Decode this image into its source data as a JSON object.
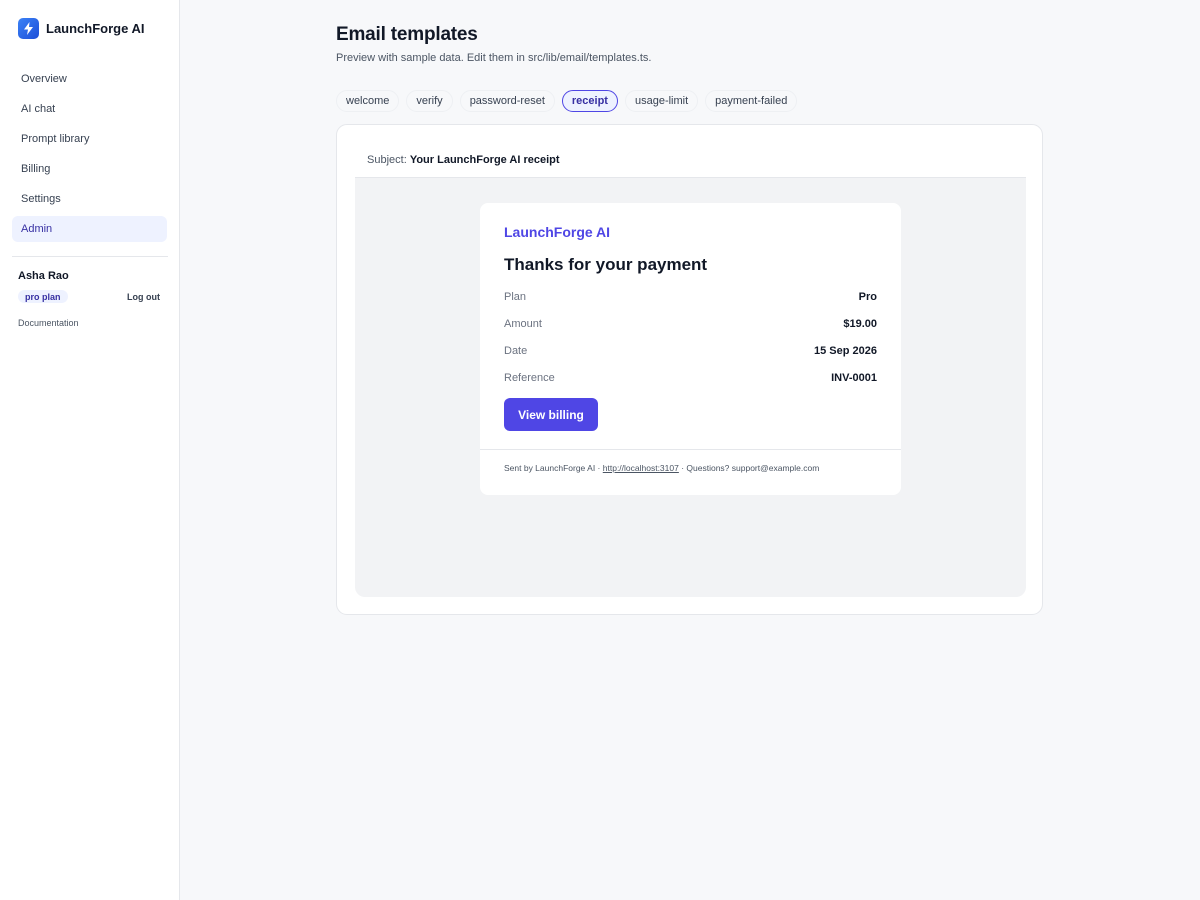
{
  "brand": {
    "name": "LaunchForge AI",
    "logo_icon": "lightning-bolt-icon",
    "logo_color": "#3b82f6"
  },
  "nav": {
    "items": [
      {
        "label": "Overview"
      },
      {
        "label": "AI chat"
      },
      {
        "label": "Prompt library"
      },
      {
        "label": "Billing"
      },
      {
        "label": "Settings"
      },
      {
        "label": "Admin",
        "active": true
      }
    ]
  },
  "user": {
    "name": "Asha Rao",
    "plan": "pro plan",
    "logout_label": "Log out"
  },
  "docs_label": "Documentation",
  "page": {
    "title": "Email templates",
    "subtitle": "Preview with sample data. Edit them in src/lib/email/templates.ts."
  },
  "tabs": [
    {
      "label": "welcome"
    },
    {
      "label": "verify"
    },
    {
      "label": "password-reset"
    },
    {
      "label": "receipt",
      "active": true
    },
    {
      "label": "usage-limit"
    },
    {
      "label": "payment-failed"
    }
  ],
  "preview": {
    "subject_label": "Subject:",
    "subject_value": "Your LaunchForge AI receipt",
    "email": {
      "brand": "LaunchForge AI",
      "heading": "Thanks for your payment",
      "rows": [
        {
          "key": "Plan",
          "value": "Pro"
        },
        {
          "key": "Amount",
          "value": "$19.00"
        },
        {
          "key": "Date",
          "value": "15 Sep 2026"
        },
        {
          "key": "Reference",
          "value": "INV-0001"
        }
      ],
      "button_label": "View billing",
      "footer_prefix": "Sent by LaunchForge AI · ",
      "footer_link": "http://localhost:3107",
      "footer_suffix": " · Questions? support@example.com"
    }
  },
  "colors": {
    "accent": "#4f46e5",
    "accent_soft": "#eef2ff",
    "brand_gradient": "#3b82f6"
  }
}
